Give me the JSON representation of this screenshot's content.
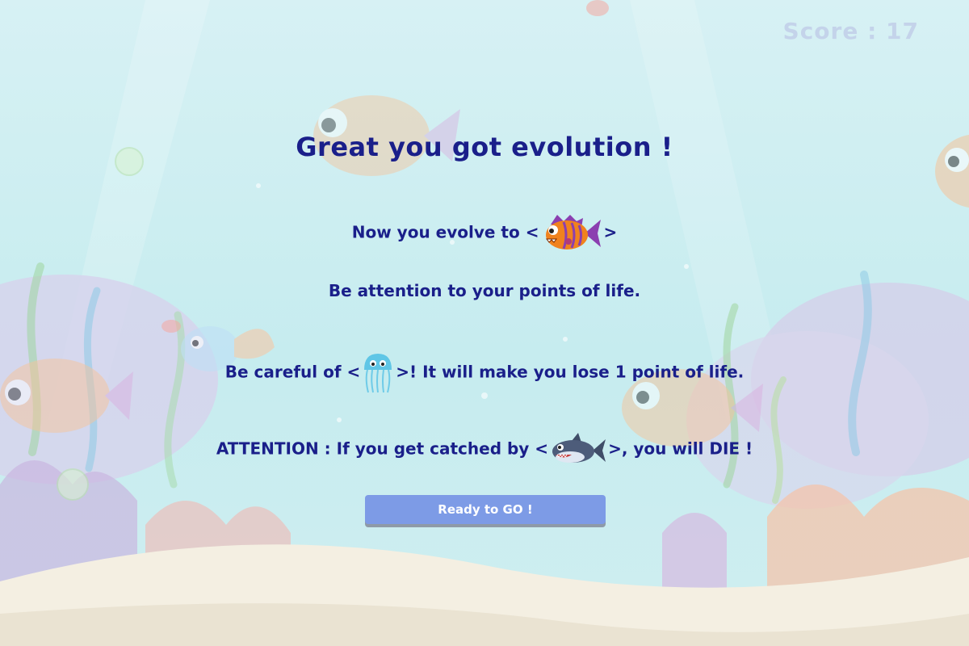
{
  "hud": {
    "score_label": "Score : 17"
  },
  "message": {
    "title": "Great you got evolution !",
    "evolve_prefix": "Now you evolve to <",
    "evolve_suffix": ">",
    "life_note": "Be attention to your points of life.",
    "jelly_prefix": "Be careful of <",
    "jelly_suffix": ">! It will make you lose 1 point of life.",
    "shark_prefix": "ATTENTION : If you get catched by <",
    "shark_suffix": ">, you will DIE !"
  },
  "buttons": {
    "ready_label": "Ready to GO !"
  },
  "icons": {
    "evolved_fish": "orange-striped-fish-icon",
    "jellyfish": "jellyfish-icon",
    "shark": "shark-icon"
  },
  "colors": {
    "text": "#1a1f8a",
    "button": "#7d9be6",
    "score": "#c4d3ea",
    "background": "#bfe6ee"
  }
}
